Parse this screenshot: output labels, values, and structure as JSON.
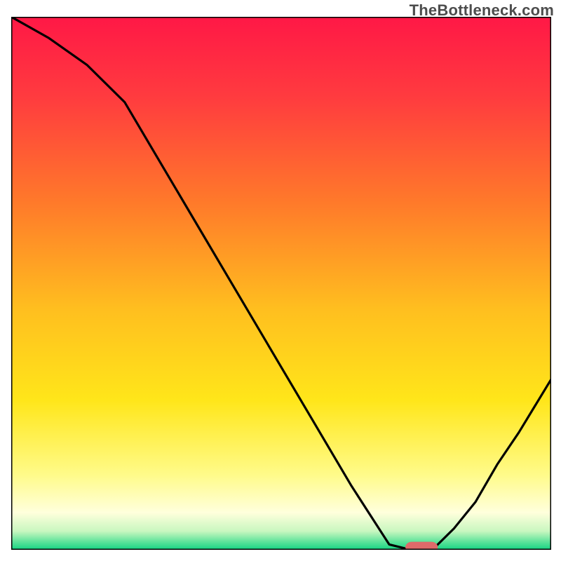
{
  "watermark": "TheBottleneck.com",
  "chart_data": {
    "type": "line",
    "title": "",
    "xlabel": "",
    "ylabel": "",
    "xlim": [
      0,
      100
    ],
    "ylim": [
      0,
      100
    ],
    "grid": false,
    "legend": false,
    "x": [
      0,
      7,
      14,
      21,
      28,
      35,
      42,
      49,
      56,
      63,
      70,
      74,
      78,
      82,
      86,
      90,
      94,
      100
    ],
    "values": [
      100,
      96,
      91,
      84,
      72,
      60,
      48,
      36,
      24,
      12,
      1,
      0,
      0,
      4,
      9,
      16,
      22,
      32
    ],
    "background_gradient_stops": [
      {
        "offset": 0.0,
        "color": "#ff1846"
      },
      {
        "offset": 0.15,
        "color": "#ff3b3f"
      },
      {
        "offset": 0.35,
        "color": "#ff7a2a"
      },
      {
        "offset": 0.55,
        "color": "#ffbf1f"
      },
      {
        "offset": 0.72,
        "color": "#ffe61a"
      },
      {
        "offset": 0.86,
        "color": "#fffb8a"
      },
      {
        "offset": 0.93,
        "color": "#ffffdc"
      },
      {
        "offset": 0.965,
        "color": "#c9f7c0"
      },
      {
        "offset": 0.985,
        "color": "#5de39a"
      },
      {
        "offset": 1.0,
        "color": "#14d483"
      }
    ],
    "marker": {
      "x_center": 76,
      "y": 0.5,
      "width": 6,
      "height": 2,
      "color": "#df6a6a",
      "rx": 1.2
    },
    "line_color": "#000000",
    "line_width": 3.2,
    "frame_color": "#000000",
    "frame_width": 3
  }
}
